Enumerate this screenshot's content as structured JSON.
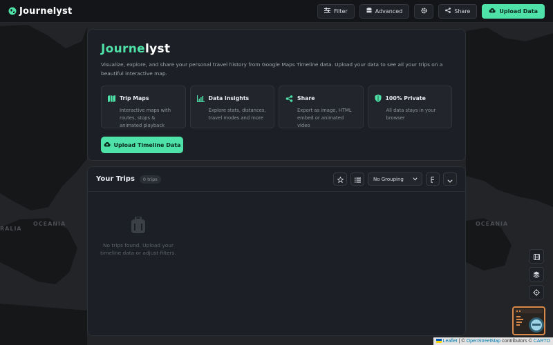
{
  "app": {
    "name": "Journelyst"
  },
  "toolbar": {
    "filter_label": "Filter",
    "advanced_label": "Advanced",
    "share_label": "Share",
    "upload_label": "Upload Data"
  },
  "hero": {
    "title_part1": "Journe",
    "title_part2": "lyst",
    "description": "Visualize, explore, and share your personal travel history from Google Maps Timeline data. Upload your data to see all your trips on a beautiful interactive map.",
    "features": [
      {
        "title": "Trip Maps",
        "description": "Interactive maps with routes, stops & animated playback",
        "icon": "map-icon"
      },
      {
        "title": "Data Insights",
        "description": "Explore stats, distances, travel modes and more",
        "icon": "chart-icon"
      },
      {
        "title": "Share",
        "description": "Export as image, HTML embed or animated video",
        "icon": "share-icon"
      },
      {
        "title": "100% Private",
        "description": "All data stays in your browser",
        "icon": "shield-icon"
      }
    ],
    "upload_label": "Upload Timeline Data"
  },
  "trips": {
    "title": "Your Trips",
    "count": "0 trips",
    "grouping": {
      "selected": "No Grouping"
    },
    "empty_text": "No trips found. Upload your timeline data or adjust filters."
  },
  "map": {
    "labels": [
      "RALIA",
      "OCEANIA",
      "OCEANIA"
    ],
    "attribution": {
      "leaflet": "Leaflet",
      "sep": "|",
      "copy1": "©",
      "osm": "OpenStreetMap",
      "contrib": "contributors ©",
      "carto": "CARTO"
    }
  },
  "colors": {
    "accent": "#4ee2a8",
    "background": "#1b1d20",
    "panel": "#1c1f25"
  }
}
